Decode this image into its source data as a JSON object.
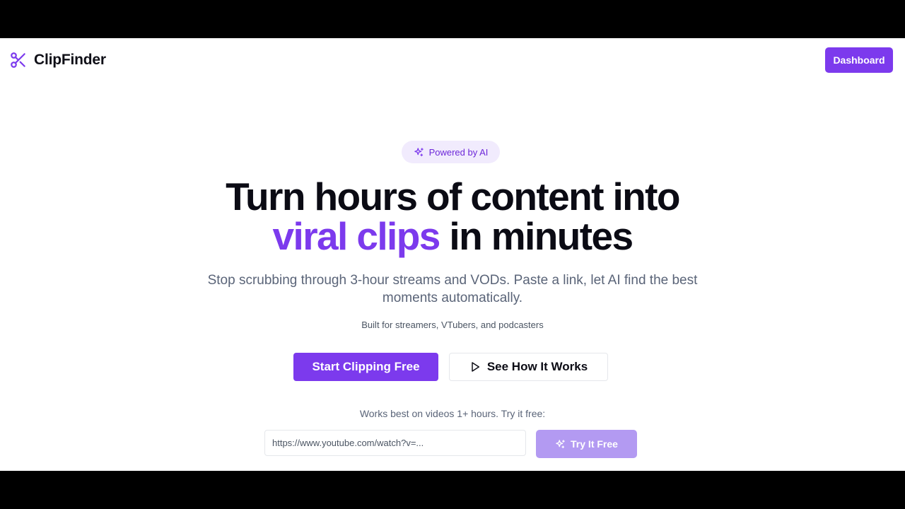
{
  "colors": {
    "brand": "#7c3aed",
    "brand_light": "#f1ebfd",
    "disabled_button": "#b39af2",
    "heading": "#0b0b14",
    "muted_text": "#5a6478"
  },
  "header": {
    "logo_icon": "scissors-icon",
    "brand_name": "ClipFinder",
    "dashboard_label": "Dashboard"
  },
  "hero": {
    "badge_icon": "sparkles-icon",
    "badge_label": "Powered by AI",
    "headline_line1": "Turn hours of content into",
    "headline_accent": "viral clips",
    "headline_rest": " in minutes",
    "subtitle": "Stop scrubbing through 3-hour streams and VODs. Paste a link, let AI find the best moments automatically.",
    "tagline": "Built for streamers, VTubers, and podcasters",
    "primary_cta": "Start Clipping Free",
    "secondary_cta_icon": "play-icon",
    "secondary_cta": "See How It Works"
  },
  "try_section": {
    "hint": "Works best on videos 1+ hours. Try it free:",
    "url_value": "",
    "url_placeholder": "https://www.youtube.com/watch?v=...",
    "button_icon": "sparkles-icon",
    "button_label": "Try It Free"
  }
}
